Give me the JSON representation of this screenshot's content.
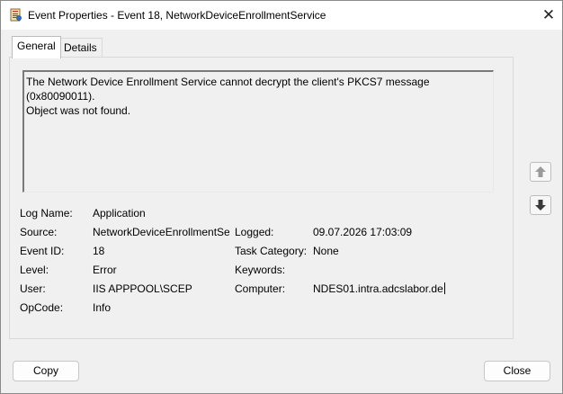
{
  "window": {
    "title": "Event Properties - Event 18, NetworkDeviceEnrollmentService",
    "icons": {
      "app": "event-viewer-icon",
      "close": "close-icon"
    }
  },
  "tabs": [
    {
      "label": "General",
      "active": true
    },
    {
      "label": "Details",
      "active": false
    }
  ],
  "message": {
    "line1": "The Network Device Enrollment Service cannot decrypt the client's PKCS7 message (0x80090011).",
    "line2": "Object was not found."
  },
  "fields": {
    "log_name_label": "Log Name:",
    "log_name_value": "Application",
    "source_label": "Source:",
    "source_value": "NetworkDeviceEnrollmentService",
    "logged_label": "Logged:",
    "logged_value": "09.07.2026 17:03:09",
    "event_id_label": "Event ID:",
    "event_id_value": "18",
    "task_category_label": "Task Category:",
    "task_category_value": "None",
    "level_label": "Level:",
    "level_value": "Error",
    "keywords_label": "Keywords:",
    "keywords_value": "",
    "user_label": "User:",
    "user_value": "IIS APPPOOL\\SCEP",
    "computer_label": "Computer:",
    "computer_value": "NDES01.intra.adcslabor.de",
    "opcode_label": "OpCode:",
    "opcode_value": "Info"
  },
  "buttons": {
    "copy": "Copy",
    "close": "Close",
    "up_icon": "arrow-up-icon",
    "down_icon": "arrow-down-icon"
  },
  "colors": {
    "window_bg": "#f0f0f0",
    "titlebar_bg": "#ffffff"
  }
}
